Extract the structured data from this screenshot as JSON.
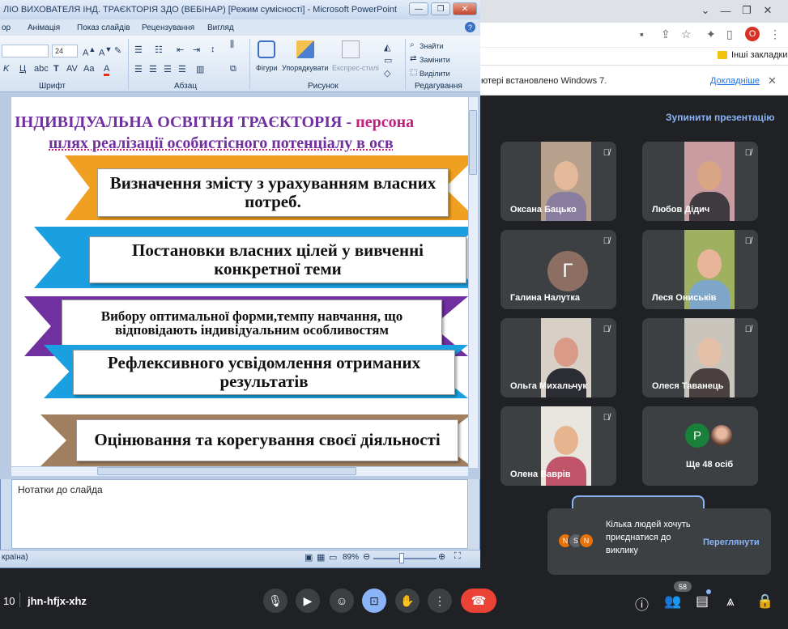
{
  "ppt": {
    "title": "ЛІО ВИХОВАТЕЛЯ  ІНД. ТРАЄКТОРІЯ ЗДО (ВЕБІНАР) [Режим сумісності] - Microsoft PowerPoint",
    "window_controls": {
      "minimize": "—",
      "restore": "❐",
      "close": "✕"
    },
    "tabs": [
      "ор",
      "Анімація",
      "Показ слайдів",
      "Рецензування",
      "Вигляд"
    ],
    "help": "?",
    "ribbon": {
      "font_size": "24",
      "groups": [
        "Шрифт",
        "Абзац",
        "Рисунок",
        "Редагування"
      ],
      "buttons": {
        "shapes": "Фігури",
        "arrange": "Упорядкувати",
        "quick_styles": "Експрес-стилі",
        "find": "Знайти",
        "replace": "Замінити",
        "select": "Виділити"
      }
    },
    "slide": {
      "title_line1_part1": "ІНДИВІДУАЛЬНА ОСВІТНЯ ТРАЄКТОРІЯ - ",
      "title_line1_part2": "персона",
      "title_line2": "шлях реалізації особистісного потенціалу в осв",
      "steps": [
        "Визначення змісту з урахуванням власних потреб.",
        "Постановки власних цілей у вивченні конкретної теми",
        "Вибору оптимальної форми,темпу навчання, що відповідають індивідуальним особливостям",
        "Рефлексивного усвідомлення отриманих  результатів",
        "Оцінювання та корегування своєї діяльності"
      ]
    },
    "notes_placeholder": "Нотатки до слайда",
    "status": {
      "language": "країна)",
      "zoom": "89%"
    },
    "colors": {
      "orange": "#f0a020",
      "blue": "#1aa0e0",
      "purple": "#7030a0",
      "tan": "#a08060"
    }
  },
  "chrome": {
    "bookmarks_label": "Інші закладки",
    "profile_initial": "O",
    "infobar_text": "ютері встановлено Windows 7.",
    "infobar_link": "Докладніше",
    "window_controls": {
      "chevron": "⌄",
      "minimize": "—",
      "restore": "❐",
      "close": "✕"
    }
  },
  "meet": {
    "stop_presentation": "Зупинити презентацію",
    "participants": [
      {
        "name": "Оксана Бацько"
      },
      {
        "name": "Любов Дідич"
      },
      {
        "name": "Галина Налутка",
        "initial": "Г"
      },
      {
        "name": "Леся Ониськів"
      },
      {
        "name": "Ольга Михальчук"
      },
      {
        "name": "Олеся Таванець"
      },
      {
        "name": "Олена Ваврів"
      }
    ],
    "more_initial": "P",
    "more_label": "Ще 48 осіб",
    "toast": {
      "initials": [
        "N",
        "S",
        "N"
      ],
      "text": "Кілька людей хочуть приєднатися до виклику",
      "action": "Переглянути"
    },
    "time_fragment": "10",
    "meeting_code": "jhn-hfjx-xhz",
    "people_count": "58",
    "accent_color": "#8ab4f8",
    "hangup_color": "#ea4335"
  }
}
